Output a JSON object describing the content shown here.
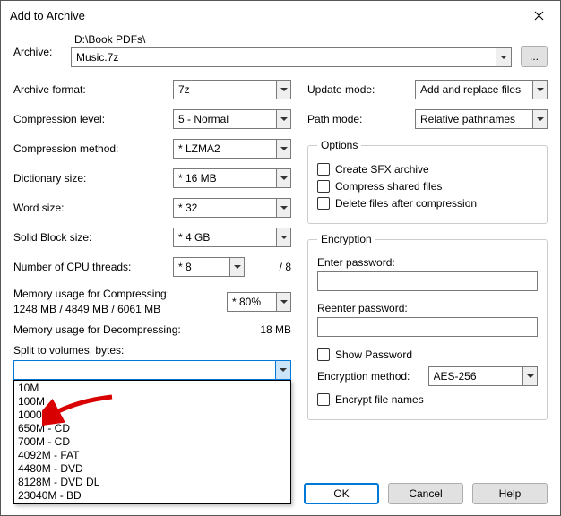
{
  "title": "Add to Archive",
  "archive_label": "Archive:",
  "archive_path": "D:\\Book PDFs\\",
  "archive_filename": "Music.7z",
  "browse_label": "...",
  "left": {
    "format_label": "Archive format:",
    "format_value": "7z",
    "level_label": "Compression level:",
    "level_value": "5 - Normal",
    "method_label": "Compression method:",
    "method_value": "* LZMA2",
    "dict_label": "Dictionary size:",
    "dict_value": "* 16 MB",
    "word_label": "Word size:",
    "word_value": "* 32",
    "block_label": "Solid Block size:",
    "block_value": "* 4 GB",
    "threads_label": "Number of CPU threads:",
    "threads_value": "* 8",
    "threads_suffix": "/ 8",
    "mem_comp_label": "Memory usage for Compressing:",
    "mem_comp_value": "1248 MB / 4849 MB / 6061 MB",
    "mem_pct_value": "* 80%",
    "mem_decomp_label": "Memory usage for Decompressing:",
    "mem_decomp_value": "18 MB",
    "split_label": "Split to volumes, bytes:",
    "split_value": "",
    "split_options": [
      "10M",
      "100M",
      "1000M",
      "650M - CD",
      "700M - CD",
      "4092M - FAT",
      "4480M - DVD",
      "8128M - DVD DL",
      "23040M - BD"
    ]
  },
  "right": {
    "update_label": "Update mode:",
    "update_value": "Add and replace files",
    "pathmode_label": "Path mode:",
    "pathmode_value": "Relative pathnames",
    "options_legend": "Options",
    "opt_sfx": "Create SFX archive",
    "opt_shared": "Compress shared files",
    "opt_delete": "Delete files after compression",
    "enc_legend": "Encryption",
    "pw_label": "Enter password:",
    "repw_label": "Reenter password:",
    "show_pw": "Show Password",
    "enc_method_label": "Encryption method:",
    "enc_method_value": "AES-256",
    "enc_names": "Encrypt file names"
  },
  "buttons": {
    "ok": "OK",
    "cancel": "Cancel",
    "help": "Help"
  }
}
